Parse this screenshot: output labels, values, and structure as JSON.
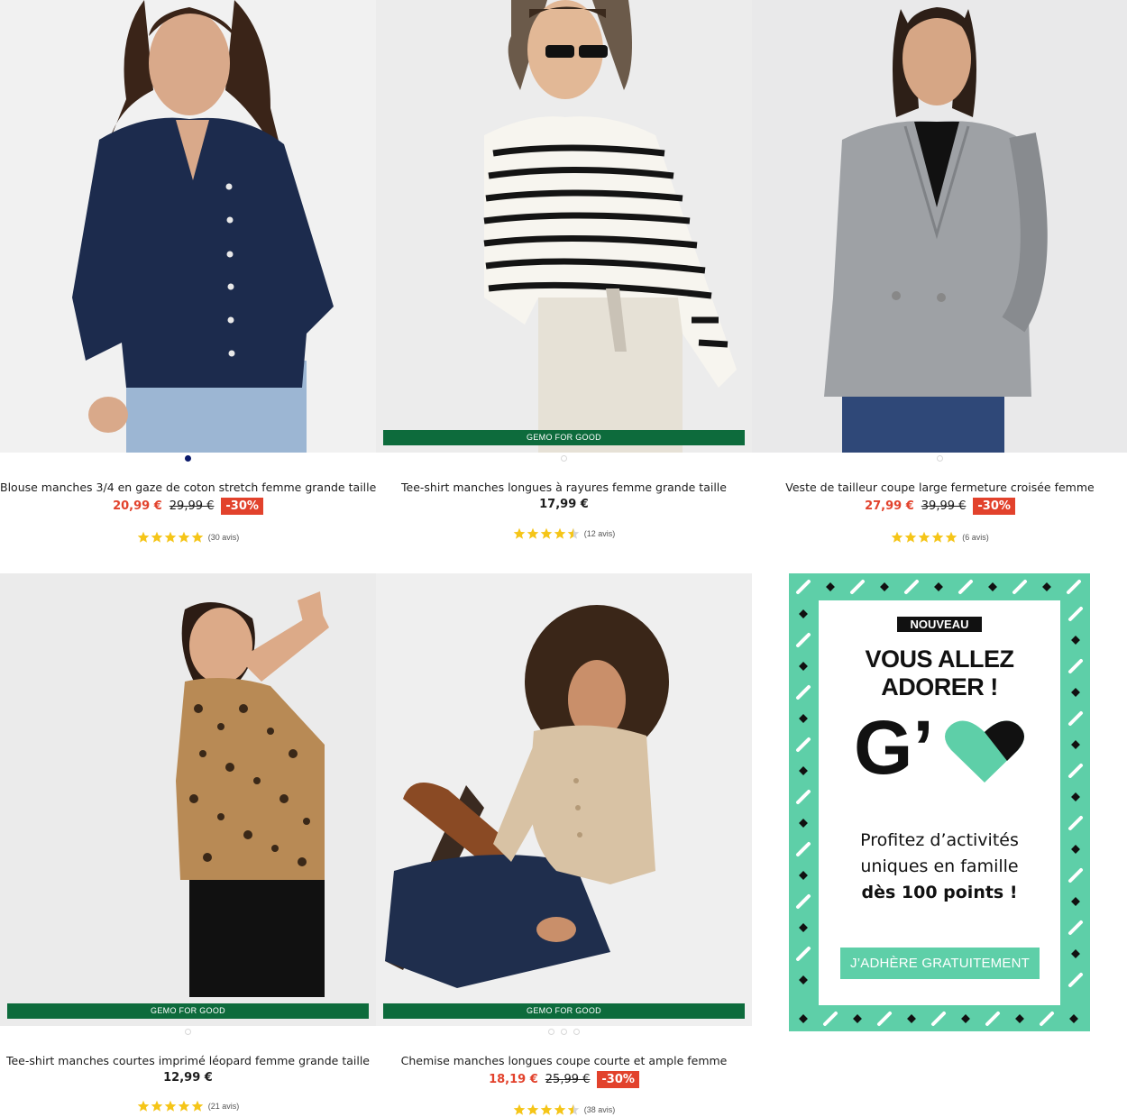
{
  "colors": {
    "sale": "#e2422c",
    "gemo_green": "#0d6b3c",
    "promo_mint": "#5ecfa8",
    "star": "#f5c518",
    "dot_active": "#0b1a6b"
  },
  "products": [
    {
      "name": "Blouse manches 3/4 en gaze de coton stretch femme grande taille",
      "price": "20,99 €",
      "old_price": "29,99 €",
      "discount": "-30%",
      "rating": 5,
      "reviews": "(30 avis)",
      "badge": "",
      "image": "navy-blouse-photo"
    },
    {
      "name": "Tee-shirt manches longues à rayures femme grande taille",
      "price": "17,99 €",
      "old_price": "",
      "discount": "",
      "rating": 4.5,
      "reviews": "(12 avis)",
      "badge": "GEMO FOR GOOD",
      "image": "striped-tee-photo"
    },
    {
      "name": "Veste de tailleur coupe large fermeture croisée femme",
      "price": "27,99 €",
      "old_price": "39,99 €",
      "discount": "-30%",
      "rating": 5,
      "reviews": "(6 avis)",
      "badge": "",
      "image": "grey-blazer-photo"
    },
    {
      "name": "Tee-shirt manches courtes imprimé léopard femme grande taille",
      "price": "12,99 €",
      "old_price": "",
      "discount": "",
      "rating": 5,
      "reviews": "(21 avis)",
      "badge": "GEMO FOR GOOD",
      "image": "leopard-tee-photo"
    },
    {
      "name": "Chemise manches longues coupe courte et ample femme",
      "price": "18,19 €",
      "old_price": "25,99 €",
      "discount": "-30%",
      "rating": 4.5,
      "reviews": "(38 avis)",
      "badge": "GEMO FOR GOOD",
      "image": "beige-shirt-photo"
    }
  ],
  "promo": {
    "tag": "NOUVEAU",
    "headline_1": "VOUS ALLEZ",
    "headline_2": "ADORER !",
    "logo_letter": "G’",
    "body_1": "Profitez d’activités",
    "body_2": "uniques en famille",
    "body_3": "dès 100 points !",
    "cta": "J’ADHÈRE GRATUITEMENT"
  }
}
